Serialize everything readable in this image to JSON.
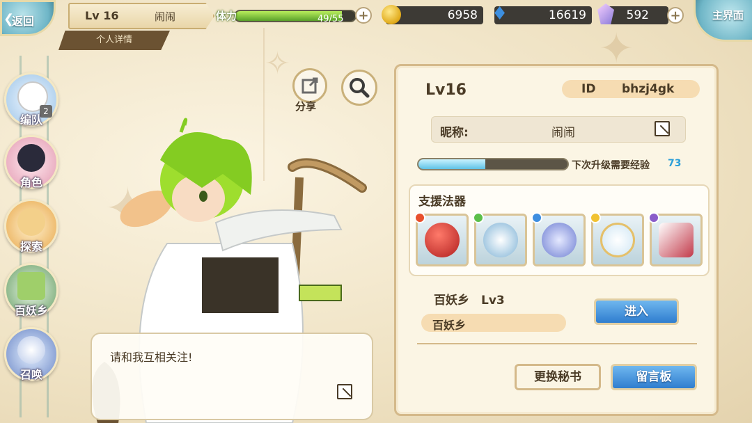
{
  "topbar": {
    "back_label": "返回",
    "level": "Lv 16",
    "player_name": "闹闹",
    "detail_tab": "个人详情",
    "stamina_label": "体力",
    "stamina_value": "49/55",
    "stamina_fraction": 0.89,
    "coins": "6958",
    "soul_fire": "16619",
    "crystals": "592",
    "home_label": "主界面"
  },
  "sidebar": {
    "items": [
      {
        "label": "编队",
        "badge": "2"
      },
      {
        "label": "角色"
      },
      {
        "label": "探索"
      },
      {
        "label": "百妖乡"
      },
      {
        "label": "召唤"
      }
    ]
  },
  "actions": {
    "share_label": "分享"
  },
  "bubble": {
    "message": "请和我互相关注!"
  },
  "panel": {
    "level": "Lv16",
    "id_key": "ID",
    "id_value": "bhzj4gk",
    "nickname_key": "昵称:",
    "nickname_value": "闹闹",
    "exp_fraction": 0.45,
    "exp_label": "下次升级需要经验",
    "exp_value": "73",
    "support_title": "支援法器",
    "village_title": "百妖乡　Lv3",
    "village_name": "百妖乡",
    "enter_button": "进入",
    "change_secretary_button": "更换秘书",
    "message_board_button": "留言板"
  },
  "colors": {
    "accent_blue": "#2f7dcf",
    "stamina_green": "#5aa12a",
    "exp_blue": "#5fc2e6",
    "panel_bg": "#fbf5e4"
  }
}
